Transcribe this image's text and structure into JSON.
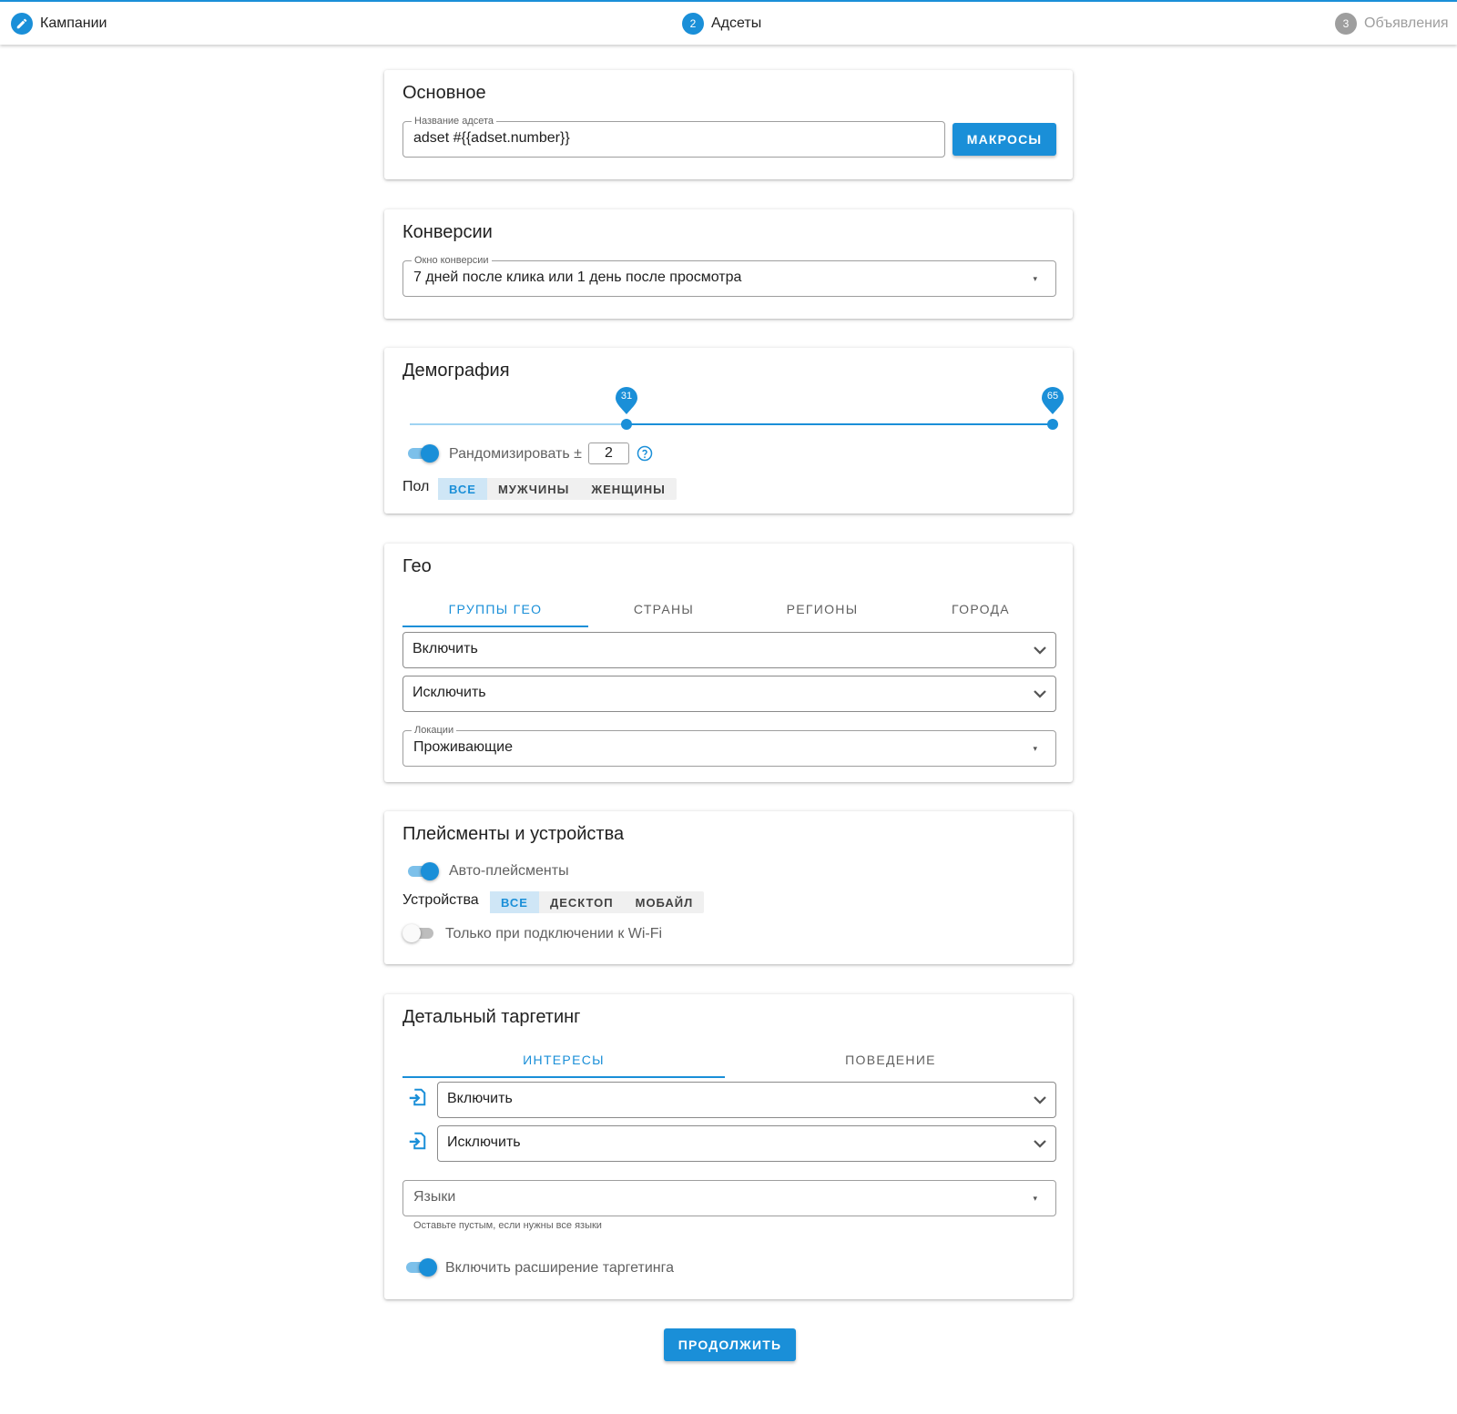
{
  "stepper": {
    "steps": [
      {
        "number": "",
        "label": "Кампании",
        "state": "done"
      },
      {
        "number": "2",
        "label": "Адсеты",
        "state": "active"
      },
      {
        "number": "3",
        "label": "Объявления",
        "state": "inactive"
      }
    ]
  },
  "basic": {
    "title": "Основное",
    "name_field": {
      "label": "Название адсета",
      "value": "adset #{{adset.number}}"
    },
    "macros_button": "МАКРОСЫ"
  },
  "conversions": {
    "title": "Конверсии",
    "window_field": {
      "label": "Окно конверсии",
      "value": "7 дней после клика или 1 день после просмотра"
    }
  },
  "demography": {
    "title": "Демография",
    "age_range": {
      "min": 31,
      "max": 65,
      "low_label": "31",
      "high_label": "65",
      "scale_min": 13,
      "scale_max": 65
    },
    "randomize": {
      "label": "Рандомизировать ±",
      "value": "2",
      "enabled": true
    },
    "gender": {
      "label": "Пол",
      "options": [
        "ВСЕ",
        "МУЖЧИНЫ",
        "ЖЕНЩИНЫ"
      ],
      "selected": 0
    }
  },
  "geo": {
    "title": "Гео",
    "tabs": [
      "ГРУППЫ ГЕО",
      "СТРАНЫ",
      "РЕГИОНЫ",
      "ГОРОДА"
    ],
    "active_tab": 0,
    "include_placeholder": "Включить",
    "exclude_placeholder": "Исключить",
    "locations_field": {
      "label": "Локации",
      "value": "Проживающие"
    }
  },
  "placements": {
    "title": "Плейсменты и устройства",
    "auto_placements": {
      "label": "Авто-плейсменты",
      "enabled": true
    },
    "devices": {
      "label": "Устройства",
      "options": [
        "ВСЕ",
        "ДЕСКТОП",
        "МОБАЙЛ"
      ],
      "selected": 0
    },
    "wifi_only": {
      "label": "Только при подключении к Wi-Fi",
      "enabled": false
    }
  },
  "targeting": {
    "title": "Детальный таргетинг",
    "tabs": [
      "ИНТЕРЕСЫ",
      "ПОВЕДЕНИЕ"
    ],
    "active_tab": 0,
    "include_placeholder": "Включить",
    "exclude_placeholder": "Исключить",
    "languages_placeholder": "Языки",
    "languages_helper": "Оставьте пустым, если нужны все языки",
    "expansion": {
      "label": "Включить расширение таргетинга",
      "enabled": true
    }
  },
  "continue_button": "ПРОДОЛЖИТЬ",
  "colors": {
    "accent": "#1a8fd8",
    "accent_light": "#cfe6f6",
    "muted": "#9e9e9e"
  }
}
